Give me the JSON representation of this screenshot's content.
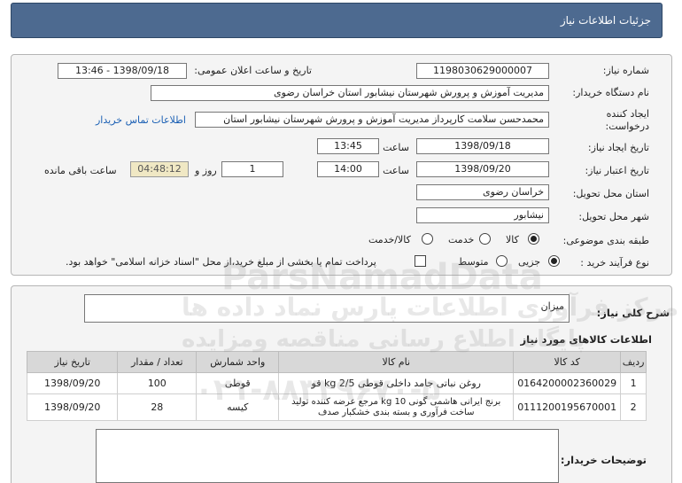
{
  "header": {
    "title": "جزئیات اطلاعات نیاز"
  },
  "form": {
    "need_number_label": "شماره نیاز:",
    "need_number": "1198030629000007",
    "announce_label": "تاریخ و ساعت اعلان عمومی:",
    "announce_value": "1398/09/18 - 13:46",
    "buyer_label": "نام دستگاه خریدار:",
    "buyer_value": "مدیریت آموزش و پرورش شهرستان نیشابور استان خراسان رضوی",
    "creator_label_1": "ایجاد کننده",
    "creator_label_2": "درخواست:",
    "creator_value": "محمدحسن سلامت کارپرداز مدیریت آموزش و پرورش شهرستان نیشابور استان",
    "contact_link": "اطلاعات تماس خریدار",
    "created_date_label": "تاریخ ایجاد نیاز:",
    "created_date": "1398/09/18",
    "time_label": "ساعت",
    "created_time": "13:45",
    "validity_label": "تاریخ اعتبار نیاز:",
    "validity_date": "1398/09/20",
    "validity_time": "14:00",
    "days_value": "1",
    "days_label": "روز و",
    "remaining_time": "04:48:12",
    "remaining_label": "ساعت باقی مانده",
    "province_label": "استان محل تحویل:",
    "province_value": "خراسان رضوی",
    "city_label": "شهر محل تحویل:",
    "city_value": "نیشابور",
    "category_label": "طبقه بندی موضوعی:",
    "category_options": [
      "کالا",
      "خدمت",
      "کالا/خدمت"
    ],
    "process_label": "نوع فرآیند خرید :",
    "process_options": [
      "جزیی",
      "متوسط"
    ],
    "payment_note": "پرداخت تمام یا بخشی از مبلغ خرید،از محل \"اسناد خزانه اسلامی\" خواهد بود."
  },
  "details": {
    "summary_label": "شرح کلی نیاز:",
    "summary_value": "میزان",
    "items_title": "اطلاعات کالاهای مورد نیاز",
    "columns": [
      "ردیف",
      "کد کالا",
      "نام کالا",
      "واحد شمارش",
      "تعداد / مقدار",
      "تاریخ نیاز"
    ],
    "rows": [
      [
        "1",
        "0164200002360029",
        "روغن نباتی جامد داخلی قوطی 2/5 kg قو",
        "قوطی",
        "100",
        "1398/09/20"
      ],
      [
        "2",
        "0111200195670001",
        "برنج ایرانی هاشمی گونی 10 kg مرجع عرضه کننده تولید ساخت فرآوری و بسته بندی خشکبار صدف",
        "کیسه",
        "28",
        "1398/09/20"
      ]
    ],
    "buyer_notes_label": "توضیحات خریدار:"
  },
  "watermark": {
    "line1": "ParsNamadData",
    "line2": "مرکز فرآوری اطلاعات پارس نماد داده ها",
    "line3": "پایگاه اطلاع رسانی مناقصه ومزایده",
    "line4": "۰۲۱-۸۸۳۴۹۶۷۰-۵"
  }
}
